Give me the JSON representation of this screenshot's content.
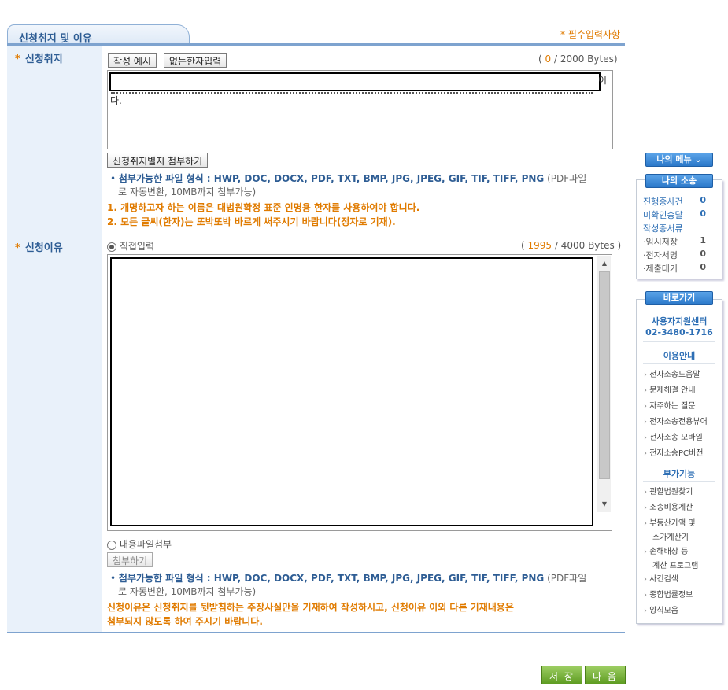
{
  "section": {
    "tab_title": "신청취지 및 이유",
    "required_note": "* 필수입력사항"
  },
  "purpose": {
    "label": "신청취지",
    "star": "*",
    "example_button": "작성 예시",
    "hanja_button": "없는한자입력",
    "counter_prefix": "( ",
    "counter_value": "0",
    "counter_suffix": " / 2000 Bytes)",
    "text_tail_right": "이",
    "text_line2": "다.",
    "attach_button": "신청취지별지 첨부하기",
    "file_note_bold": "첨부가능한 파일 형식 : HWP, DOC, DOCX, PDF, TXT, BMP, JPG, JPEG, GIF, TIF, TIFF, PNG",
    "file_note_tail": "(PDF파일",
    "file_note_line2": "로 자동변환, 10MB까지 첨부가능)",
    "warning1": "1. 개명하고자 하는 이름은 대법원확정 표준 인명용 한자를 사용하여야 합니다.",
    "warning2": "2. 모든 글씨(한자)는 또박또박 바르게 써주시기 바랍니다(정자로 기재)."
  },
  "reason": {
    "label": "신청이유",
    "star": "*",
    "direct_input_label": "직접입력",
    "counter_prefix": "( ",
    "counter_value": "1995",
    "counter_suffix": " / 4000 Bytes )",
    "file_radio_label": "내용파일첨부",
    "attach_button": "첨부하기",
    "file_note_bold": "첨부가능한 파일 형식 : HWP, DOC, DOCX, PDF, TXT, BMP, JPG, JPEG, GIF, TIF, TIFF, PNG",
    "file_note_tail": "(PDF파일",
    "file_note_line2": "로 자동변환, 10MB까지 첨부가능)",
    "warning_line1": "신청이유은 신청취지를 뒷받침하는 주장사실만을 기재하여 작성하시고, 신청이유 이외 다른 기재내용은",
    "warning_line2": "첨부되지 않도록 하여 주시기 바랍니다."
  },
  "footer": {
    "save_button": "저 장",
    "next_button": "다 음"
  },
  "sidebar": {
    "my_menu": "나의 메뉴 ⌄",
    "my_case": "나의 소송",
    "rows": [
      {
        "label": "진행중사건",
        "value": "0"
      },
      {
        "label": "미확인송달",
        "value": "0"
      },
      {
        "label": "작성중서류",
        "value": ""
      }
    ],
    "subrows": [
      {
        "label": "·임시저장",
        "value": "1"
      },
      {
        "label": "·전자서명",
        "value": "0"
      },
      {
        "label": "·제출대기",
        "value": "0"
      }
    ],
    "shortcut": "바로가기",
    "support_center": "사용자지원센터",
    "support_phone": "02-3480-1716",
    "usage_head": "이용안내",
    "usage_links": [
      "전자소송도움말",
      "문제해결 안내",
      "자주하는 질문",
      "전자소송전용뷰어",
      "전자소송 모바일",
      "전자소송PC버전"
    ],
    "extra_head": "부가기능",
    "extra_links": [
      "관할법원찾기",
      "소송비용계산",
      "부동산가액 및",
      "소가계산기",
      "손해배상 등",
      "계산 프로그램",
      "사건검색",
      "종합법률정보",
      "양식모음"
    ]
  },
  "colors": {
    "accent": "#2e5d94",
    "warning": "#e07b00",
    "label_bg": "#e9f1fa",
    "green": "#5e9c22",
    "blue_pill": "#2b78c9"
  }
}
